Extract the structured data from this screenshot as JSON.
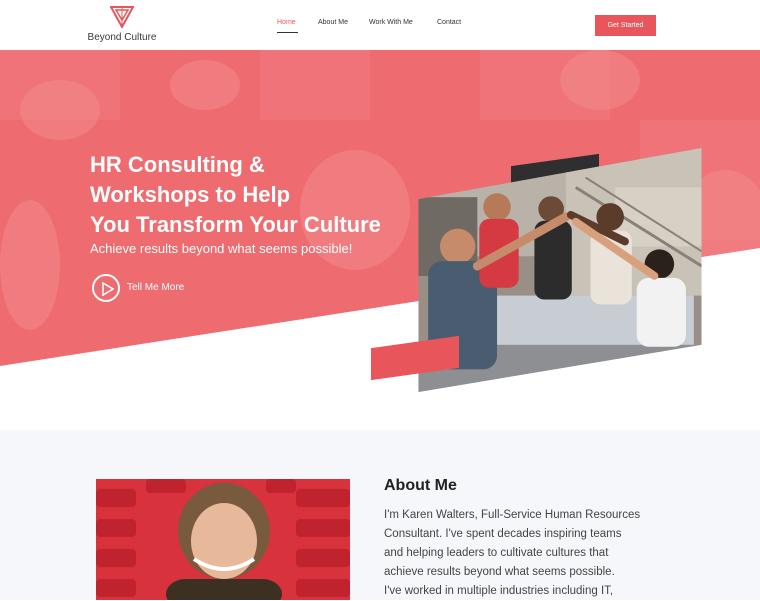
{
  "header": {
    "logo_text": "Beyond Culture",
    "nav": [
      {
        "label": "Home",
        "active": true
      },
      {
        "label": "About Me",
        "active": false
      },
      {
        "label": "Work With Me",
        "active": false
      },
      {
        "label": "Contact",
        "active": false
      }
    ],
    "cta_label": "Get Started"
  },
  "hero": {
    "title_lines": [
      "HR Consulting &",
      "Workshops to Help",
      "You Transform Your Culture"
    ],
    "subtitle": "Achieve results beyond what seems possible!",
    "play_label": "Tell Me More",
    "play_icon": "play-icon"
  },
  "about": {
    "title": "About Me",
    "text_lines": [
      "I'm Karen Walters, Full-Service Human Resources",
      "Consultant. I've spent decades inspiring teams",
      "and helping leaders to cultivate cultures that",
      "achieve results beyond what seems possible.",
      "I've worked in multiple industries including IT,"
    ]
  },
  "colors": {
    "accent": "#e8555a",
    "hero_bg": "#ee6b6f",
    "dark_bar": "#2f2f2f",
    "section_bg": "#f6f7fa"
  }
}
